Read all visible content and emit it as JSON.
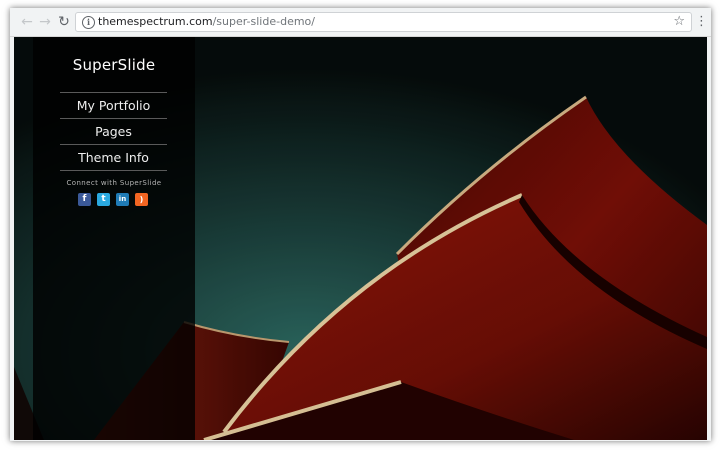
{
  "browser": {
    "url_domain": "themespectrum.com",
    "url_path": "/super-slide-demo/",
    "icons": [
      "back-icon",
      "forward-icon",
      "reload-icon",
      "info-icon",
      "star-icon",
      "menu-icon"
    ]
  },
  "site": {
    "title": "SuperSlide",
    "menu": [
      "My Portfolio",
      "Pages",
      "Theme Info"
    ],
    "connect_text": "Connect with SuperSlide",
    "social_icons": [
      "facebook-icon",
      "twitter-icon",
      "linkedin-icon",
      "rss-icon"
    ]
  },
  "colors": {
    "sky": "#1e4d48",
    "roof_red": "#8a1208",
    "roof_edge": "#e0c08c",
    "sidebar": "#000000"
  }
}
